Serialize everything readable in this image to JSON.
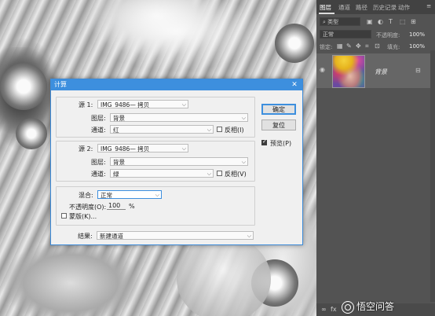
{
  "dialog": {
    "title": "计算",
    "close": "✕",
    "source1": {
      "label": "源 1:",
      "file": "IMG_9486— 拷贝",
      "layer_label": "图层:",
      "layer": "背景",
      "channel_label": "通道:",
      "channel": "红",
      "invert_label": "反相(I)"
    },
    "source2": {
      "label": "源 2:",
      "file": "IMG_9486— 拷贝",
      "layer_label": "图层:",
      "layer": "背景",
      "channel_label": "通道:",
      "channel": "绿",
      "invert_label": "反相(V)"
    },
    "blend": {
      "label": "混合:",
      "mode": "正常",
      "opacity_label": "不透明度(O):",
      "opacity": "100",
      "opacity_unit": "%",
      "mask_label": "蒙版(K)..."
    },
    "result": {
      "label": "结果:",
      "value": "新建通道"
    },
    "ok": "确定",
    "reset": "复位",
    "preview_label": "预览(P)",
    "preview_checked": true
  },
  "panel": {
    "tabs": [
      "图层",
      "通道",
      "路径",
      "历史记录",
      "动作"
    ],
    "menu_icon": "≡",
    "kind_label": "类型",
    "filter_icons": [
      "▣",
      "◐",
      "T",
      "⬚",
      "⊞"
    ],
    "blend_mode": "正常",
    "opacity_label": "不透明度:",
    "opacity": "100%",
    "lock_label": "锁定:",
    "fill_label": "填充:",
    "fill": "100%",
    "layer_name": "背景",
    "lock_icon": "🔒",
    "eye_icon": "👁",
    "bottom_icons": [
      "∞",
      "fx",
      "◘",
      "◐",
      "▭",
      "▫",
      "🗑"
    ]
  },
  "watermark": "悟空问答",
  "colors": {
    "accent": "#3d8fde",
    "panel_bg": "#535353",
    "dialog_bg": "#f0f0f0"
  }
}
